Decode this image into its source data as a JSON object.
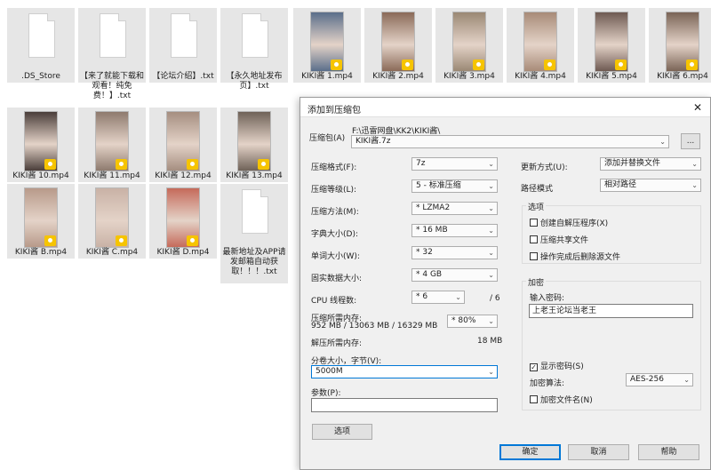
{
  "files": [
    {
      "name": ".DS_Store",
      "kind": "doc"
    },
    {
      "name": "【来了就能下载和观看！纯免费！】.txt",
      "kind": "doc"
    },
    {
      "name": "【论坛介绍】.txt",
      "kind": "doc"
    },
    {
      "name": "【永久地址发布页】.txt",
      "kind": "doc"
    },
    {
      "name": "KIKI酱 1.mp4",
      "kind": "video"
    },
    {
      "name": "KIKI酱 2.mp4",
      "kind": "video"
    },
    {
      "name": "KIKI酱 3.mp4",
      "kind": "video"
    },
    {
      "name": "KIKI酱 4.mp4",
      "kind": "video"
    },
    {
      "name": "KIKI酱 5.mp4",
      "kind": "video"
    },
    {
      "name": "KIKI酱 6.mp4",
      "kind": "video"
    },
    {
      "name": "KIKI酱 10.mp4",
      "kind": "video"
    },
    {
      "name": "KIKI酱 11.mp4",
      "kind": "video"
    },
    {
      "name": "KIKI酱 12.mp4",
      "kind": "video"
    },
    {
      "name": "KIKI酱 13.mp4",
      "kind": "video"
    },
    {
      "name": "KIKI酱 B.mp4",
      "kind": "video"
    },
    {
      "name": "KIKI酱 C.mp4",
      "kind": "video"
    },
    {
      "name": "KIKI酱 D.mp4",
      "kind": "video"
    },
    {
      "name": "最新地址及APP请发邮箱自动获取！！！.txt",
      "kind": "doc"
    }
  ],
  "dialog": {
    "title": "添加到压缩包",
    "close": "✕",
    "archive_label": "压缩包(A)",
    "archive_dir": "F:\\迅雷网盘\\KK2\\KIKI酱\\",
    "archive_name": "KIKI酱.7z",
    "browse": "...",
    "format_label": "压缩格式(F):",
    "format_value": "7z",
    "level_label": "压缩等级(L):",
    "level_value": "5 - 标准压缩",
    "method_label": "压缩方法(M):",
    "method_value": "* LZMA2",
    "dict_label": "字典大小(D):",
    "dict_value": "* 16 MB",
    "word_label": "单词大小(W):",
    "word_value": "* 32",
    "solid_label": "固实数据大小:",
    "solid_value": "* 4 GB",
    "cpu_label": "CPU 线程数:",
    "cpu_value": "* 6",
    "cpu_total": "/ 6",
    "mem_label": "压缩所需内存:",
    "mem_values": "952 MB / 13063 MB / 16329 MB",
    "mem_pct": "* 80%",
    "demem_label": "解压所需内存:",
    "demem_value": "18 MB",
    "split_label": "分卷大小，字节(V):",
    "split_value": "5000M",
    "params_label": "参数(P):",
    "params_value": "",
    "options_button": "选项",
    "update_label": "更新方式(U):",
    "update_value": "添加并替换文件",
    "path_label": "路径模式",
    "path_value": "相对路径",
    "options_group": "选项",
    "opt_sfx": "创建自解压程序(X)",
    "opt_shared": "压缩共享文件",
    "opt_delete": "操作完成后删除源文件",
    "encrypt_group": "加密",
    "password_label": "输入密码:",
    "password_value": "上老王论坛当老王",
    "show_password": "显示密码(S)",
    "enc_method_label": "加密算法:",
    "enc_method_value": "AES-256",
    "enc_names": "加密文件名(N)",
    "ok": "确定",
    "cancel": "取消",
    "help": "帮助"
  },
  "icons": {
    "dropdown": "chevron-down-icon",
    "check": "✓"
  },
  "colors": {
    "accent": "#0078d7",
    "tile_bg": "#e6e6e6",
    "badge": "#f6c400"
  }
}
